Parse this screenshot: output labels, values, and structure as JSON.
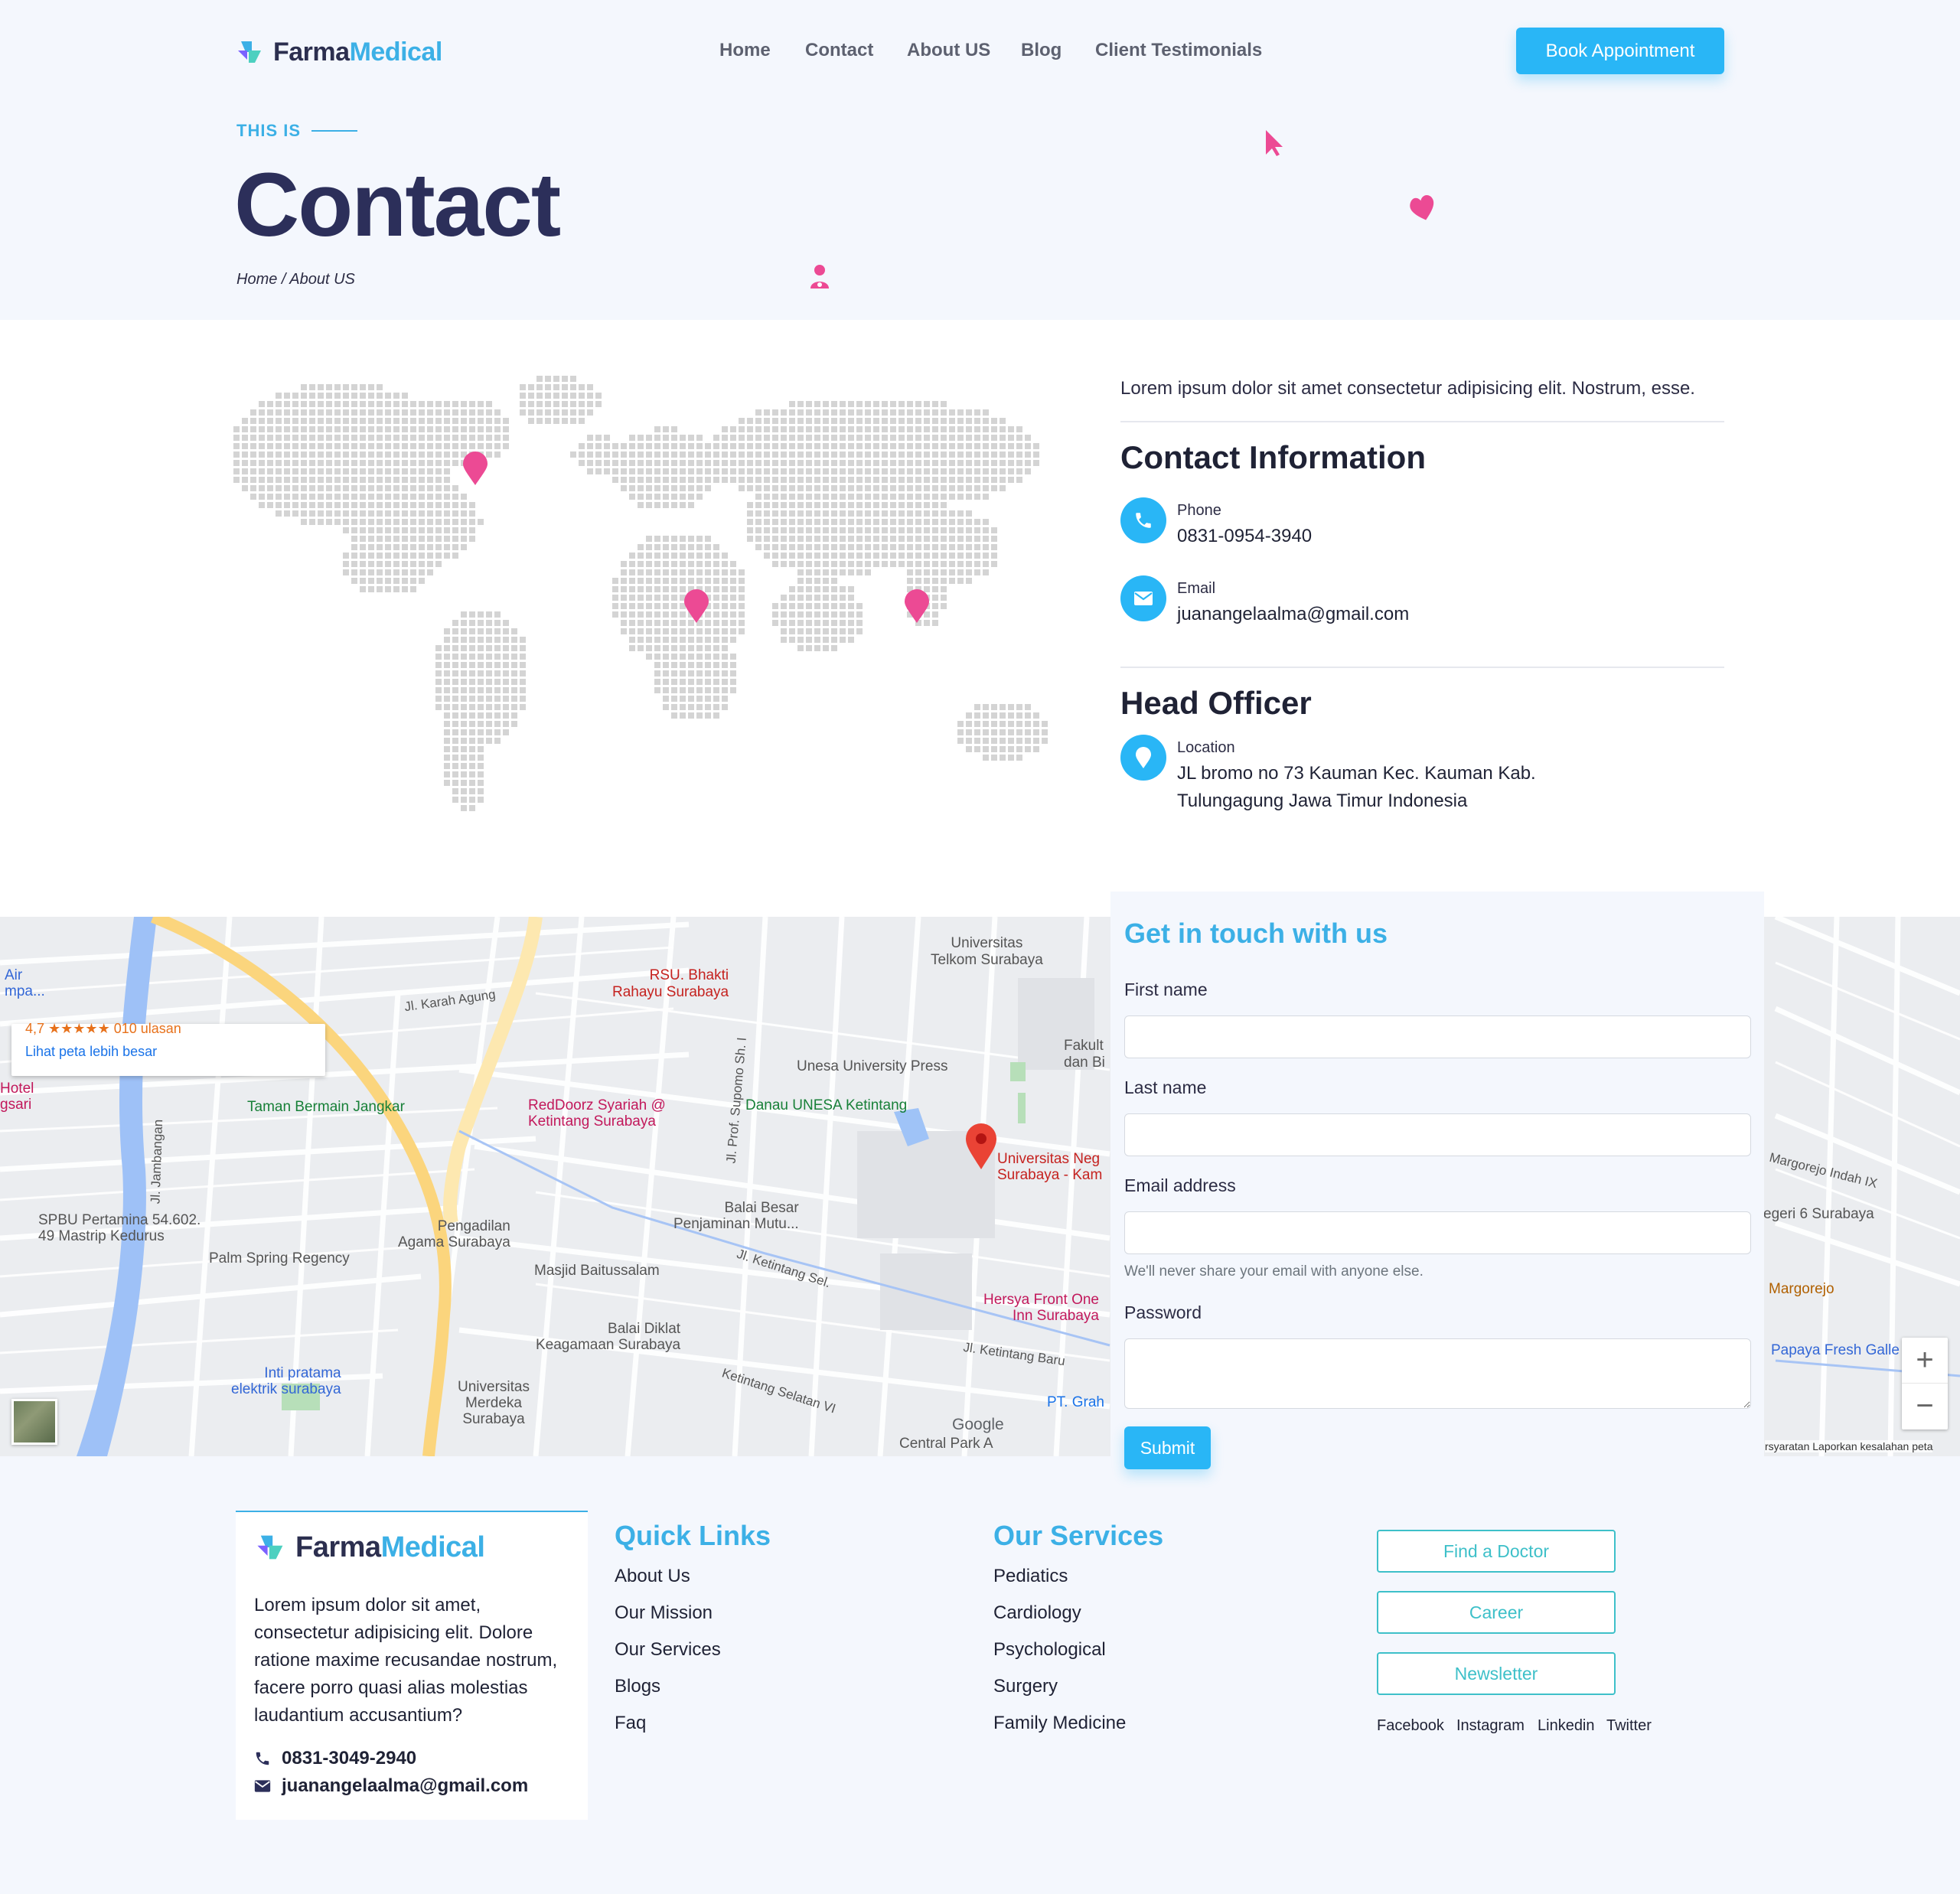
{
  "header": {
    "logo_a": "Farma",
    "logo_b": "Medical",
    "nav": [
      "Home",
      "Contact",
      "About US",
      "Blog",
      "Client Testimonials"
    ],
    "cta": "Book Appointment"
  },
  "hero": {
    "eyebrow": "THIS IS",
    "title": "Contact",
    "breadcrumb": "Home / About US"
  },
  "contact": {
    "lead": "Lorem ipsum dolor sit amet consectetur adipisicing elit. Nostrum, esse.",
    "info_title": "Contact Information",
    "phone_label": "Phone",
    "phone_value": "0831-0954-3940",
    "email_label": "Email",
    "email_value": "juanangelaalma@gmail.com",
    "office_title": "Head Officer",
    "location_label": "Location",
    "location_line1": "JL bromo no 73 Kauman Kec. Kauman Kab.",
    "location_line2": "Tulungagung Jawa Timur Indonesia"
  },
  "map": {
    "bigger_map": "Lihat peta lebih besar",
    "rating": "4,7 ★★★★★ 010 ulasan",
    "labels": {
      "rsu": "RSU. Bhakti",
      "rsu2": "Rahayu Surabaya",
      "telkom": "Universitas",
      "telkom2": "Telkom Surabaya",
      "fakult": "Fakult",
      "fakult2": "dan Bi",
      "unesa_press": "Unesa University Press",
      "danau": "Danau UNESA Ketintang",
      "taman": "Taman Bermain Jangkar",
      "reddoorz": "RedDoorz Syariah @",
      "reddoorz2": "Ketintang Surabaya",
      "unesa": "Universitas Neg",
      "unesa2": "Surabaya - Kam",
      "balai": "Balai Besar",
      "balai2": "Penjaminan Mutu...",
      "pengadilan": "Pengadilan",
      "pengadilan2": "Agama Surabaya",
      "spbu": "SPBU Pertamina 54.602.",
      "spbu2": "49 Mastrip Kedurus",
      "palm": "Palm Spring Regency",
      "masjid": "Masjid Baitussalam",
      "hersya": "Hersya Front One",
      "hersya2": "Inn Surabaya",
      "diklat": "Balai Diklat",
      "diklat2": "Keagamaan Surabaya",
      "inti": "Inti pratama",
      "inti2": "elektrik surabaya",
      "merdeka": "Universitas",
      "merdeka2": "Merdeka",
      "merdeka3": "Surabaya",
      "grah": "PT. Grah",
      "central": "Central Park A",
      "margorejo_indah": "Margorejo Indah IX",
      "negeri6": "egeri 6 Surabaya",
      "margorejo": "Margorejo",
      "papaya": "Papaya Fresh Galle",
      "hotel": "Hotel",
      "hotel2": "gsari",
      "air": "Air",
      "air2": "mpa...",
      "road_karah_agung": "Jl. Karah Agung",
      "road_ketintang": "Jl. Ketintang Sel.",
      "road_jambangan": "Jl. Jambangan",
      "road_supomo": "Jl. Prof. Supomo Sh. I",
      "road_ketintang_baru": "Jl. Ketintang Baru",
      "road_ketintang_selatan": "Ketintang Selatan VI",
      "google": "Google",
      "terms": "rsyaratan   Laporkan kesalahan peta"
    }
  },
  "form": {
    "title": "Get in touch with us",
    "first_name": "First name",
    "last_name": "Last name",
    "email": "Email address",
    "email_help": "We'll never share your email with anyone else.",
    "password": "Password",
    "submit": "Submit"
  },
  "footer": {
    "about": "Lorem ipsum dolor sit amet, consectetur adipisicing elit. Dolore ratione maxime recusandae nostrum, facere porro quasi alias molestias laudantium accusantium?",
    "phone": "0831-3049-2940",
    "email": "juanangelaalma@gmail.com",
    "quick_title": "Quick Links",
    "quick_links": [
      "About Us",
      "Our Mission",
      "Our Services",
      "Blogs",
      "Faq"
    ],
    "services_title": "Our Services",
    "services": [
      "Pediatics",
      "Cardiology",
      "Psychological",
      "Surgery",
      "Family Medicine"
    ],
    "buttons": [
      "Find a Doctor",
      "Career",
      "Newsletter"
    ],
    "social": [
      "Facebook",
      "Instagram",
      "Linkedin",
      "Twitter"
    ]
  },
  "colors": {
    "primary": "#29b6f6",
    "accent_pink": "#ec4a94",
    "navy": "#2c2f5a",
    "teal_outline": "#3ec0c9"
  }
}
